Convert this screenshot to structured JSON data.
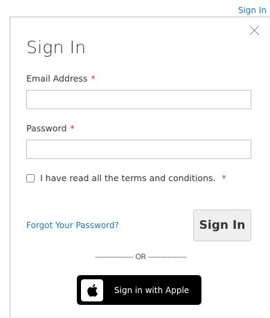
{
  "header": {
    "signin_link": "Sign In"
  },
  "modal": {
    "title": "Sign In",
    "email": {
      "label": "Email Address",
      "required_mark": "*",
      "value": "",
      "placeholder": ""
    },
    "password": {
      "label": "Password",
      "required_mark": "*",
      "value": "",
      "placeholder": ""
    },
    "terms": {
      "label": "I have read all the terms and conditions.",
      "required_mark": "*",
      "checked": false
    },
    "forgot_link": "Forgot Your Password?",
    "signin_button": "Sign In",
    "divider": "---------------- OR ----------------",
    "apple_button": "Sign in with Apple",
    "icons": {
      "close": "close-icon",
      "apple": "apple-icon"
    }
  },
  "colors": {
    "link": "#1979c3",
    "required": "#e02b27",
    "apple_button_bg": "#000000"
  }
}
